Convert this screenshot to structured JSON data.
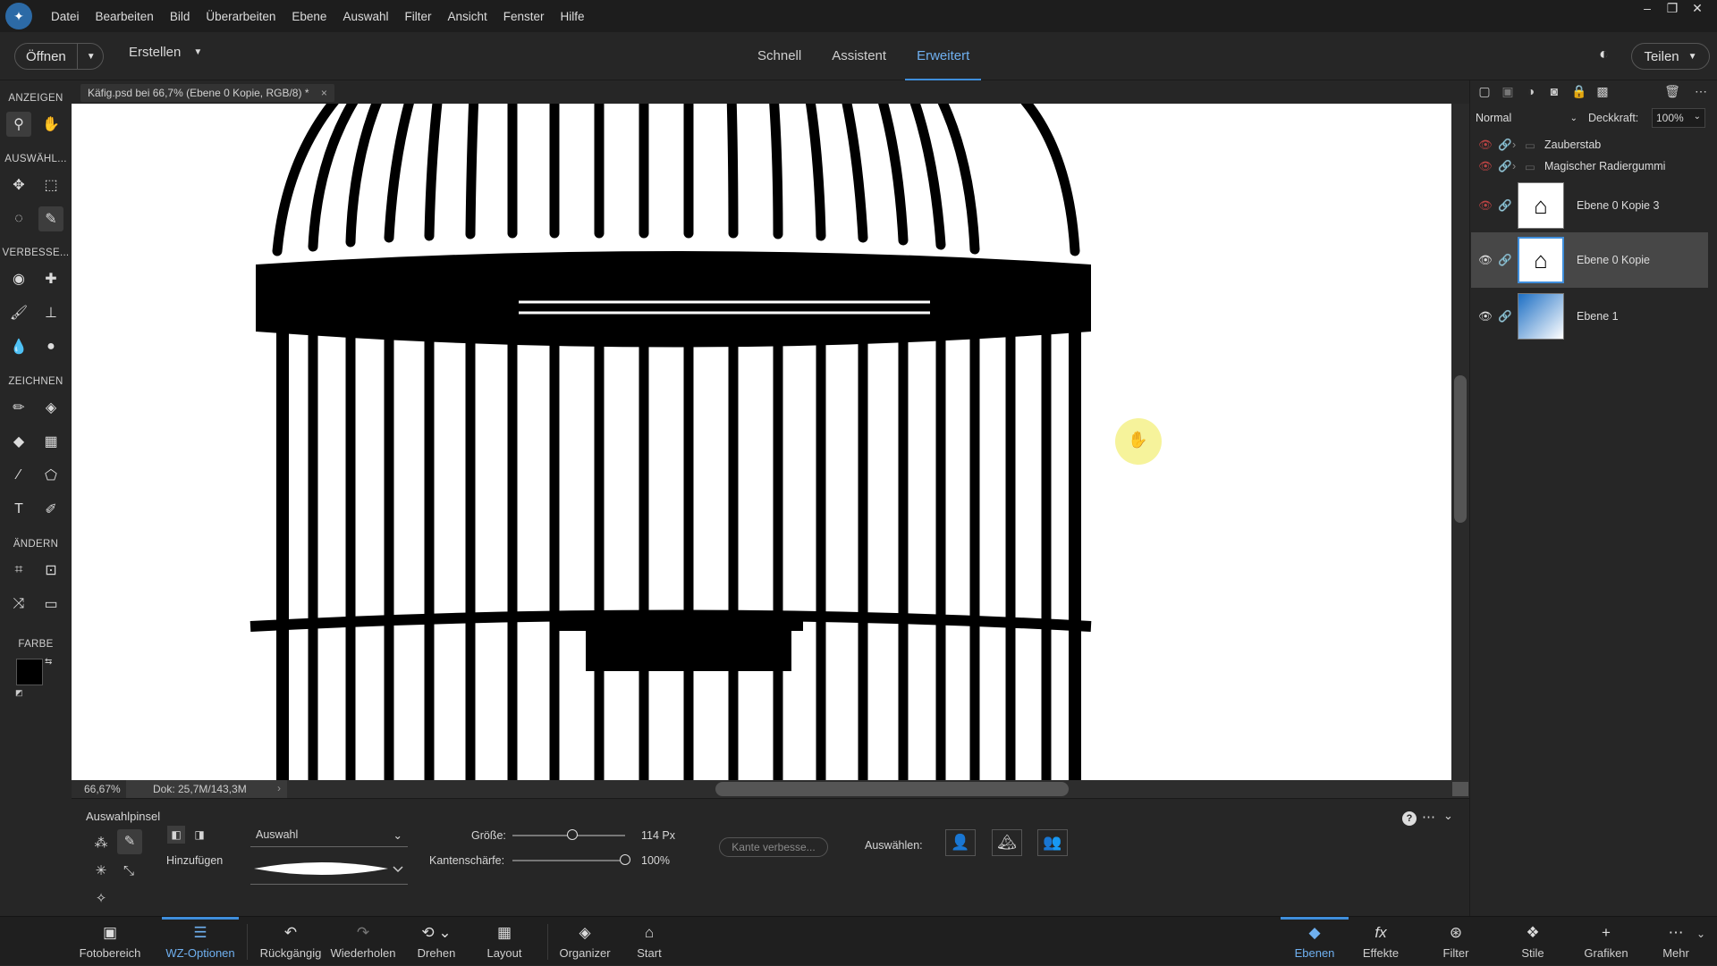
{
  "menubar": {
    "items": [
      "Datei",
      "Bearbeiten",
      "Bild",
      "Überarbeiten",
      "Ebene",
      "Auswahl",
      "Filter",
      "Ansicht",
      "Fenster",
      "Hilfe"
    ]
  },
  "topbar": {
    "open_label": "Öffnen",
    "create_label": "Erstellen",
    "modes": [
      "Schnell",
      "Assistent",
      "Erweitert"
    ],
    "active_mode": "Erweitert",
    "share_label": "Teilen"
  },
  "tools": {
    "sections": {
      "view": "ANZEIGEN",
      "select": "AUSWÄHL...",
      "enhance": "VERBESSE...",
      "draw": "ZEICHNEN",
      "modify": "ÄNDERN",
      "color": "FARBE"
    }
  },
  "document": {
    "tab_title": "Käfig.psd bei 66,7% (Ebene 0 Kopie, RGB/8) *",
    "zoom": "66,67%",
    "doc_size": "Dok: 25,7M/143,3M"
  },
  "layers_panel": {
    "blend_mode": "Normal",
    "opacity_label": "Deckkraft:",
    "opacity_value": "100%",
    "groups": [
      "Zauberstab",
      "Magischer Radiergummi"
    ],
    "layers": [
      {
        "name": "Ebene 0 Kopie 3",
        "selected": false
      },
      {
        "name": "Ebene 0 Kopie",
        "selected": true
      },
      {
        "name": "Ebene 1",
        "selected": false
      }
    ]
  },
  "options": {
    "tool_name": "Auswahlpinsel",
    "add_label": "Hinzufügen",
    "mode_select": "Auswahl",
    "size_label": "Größe:",
    "size_value": "114 Px",
    "size_fraction": 0.53,
    "softness_label": "Kantenschärfe:",
    "softness_value": "100%",
    "softness_fraction": 1.0,
    "refine_button": "Kante verbesse...",
    "select_label": "Auswählen:"
  },
  "taskbar": {
    "items": [
      "Fotobereich",
      "WZ-Optionen",
      "Rückgängig",
      "Wiederholen",
      "Drehen",
      "Layout",
      "Organizer",
      "Start"
    ],
    "right_items": [
      "Ebenen",
      "Effekte",
      "Filter",
      "Stile",
      "Grafiken",
      "Mehr"
    ],
    "active_left": "WZ-Optionen",
    "active_right": "Ebenen"
  },
  "colors": {
    "accent": "#3f8edb",
    "accent_text": "#6fb0f0",
    "panel": "#262626",
    "menubar": "#1d1d1d"
  }
}
